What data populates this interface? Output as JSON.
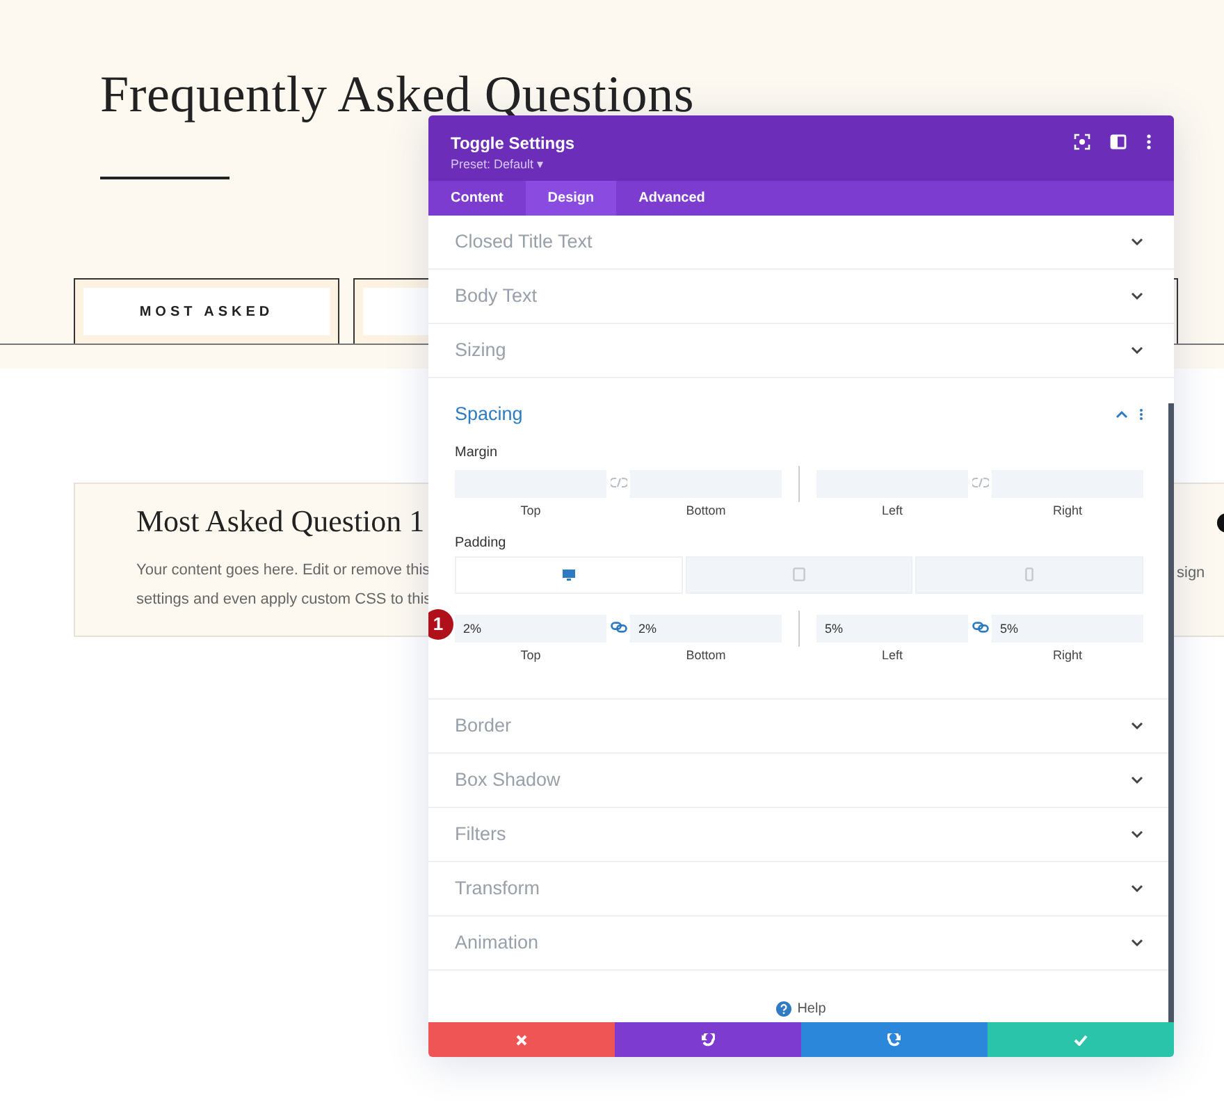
{
  "page": {
    "heading": "Frequently Asked Questions",
    "filter_tabs": [
      {
        "label": "MOST ASKED",
        "selected": true
      }
    ],
    "toggle": {
      "title": "Most Asked Question 1",
      "lines": [
        "Your content goes here. Edit or remove this",
        "settings and even apply custom CSS to this"
      ],
      "right_fragment": "sign"
    }
  },
  "modal": {
    "title": "Toggle Settings",
    "preset": "Preset: Default",
    "preset_caret": "▾",
    "tabs": [
      {
        "label": "Content",
        "selected": false
      },
      {
        "label": "Design",
        "selected": true
      },
      {
        "label": "Advanced",
        "selected": false
      }
    ],
    "sections": [
      {
        "title": "Closed Title Text",
        "expanded": false
      },
      {
        "title": "Body Text",
        "expanded": false
      },
      {
        "title": "Sizing",
        "expanded": false
      },
      {
        "title": "Spacing",
        "expanded": true,
        "groups": [
          {
            "label": "Margin",
            "linked": [
              false,
              false
            ],
            "fields": [
              {
                "caption": "Top"
              },
              {
                "caption": "Bottom"
              },
              {
                "caption": "Left"
              },
              {
                "caption": "Right"
              }
            ]
          },
          {
            "label": "Padding",
            "devices": [
              {
                "kind": "desktop",
                "selected": true
              },
              {
                "kind": "tablet",
                "selected": false
              },
              {
                "kind": "phone",
                "selected": false
              }
            ],
            "step_badge": "1",
            "linked": [
              true,
              true
            ],
            "fields": [
              {
                "value": "2%",
                "caption": "Top"
              },
              {
                "value": "2%",
                "caption": "Bottom"
              },
              {
                "value": "5%",
                "caption": "Left"
              },
              {
                "value": "5%",
                "caption": "Right"
              }
            ]
          }
        ]
      },
      {
        "title": "Border",
        "expanded": false
      },
      {
        "title": "Box Shadow",
        "expanded": false
      },
      {
        "title": "Filters",
        "expanded": false
      },
      {
        "title": "Transform",
        "expanded": false
      },
      {
        "title": "Animation",
        "expanded": false
      }
    ],
    "help": "Help",
    "footer": [
      {
        "kind": "cancel"
      },
      {
        "kind": "undo"
      },
      {
        "kind": "redo"
      },
      {
        "kind": "save"
      }
    ]
  }
}
